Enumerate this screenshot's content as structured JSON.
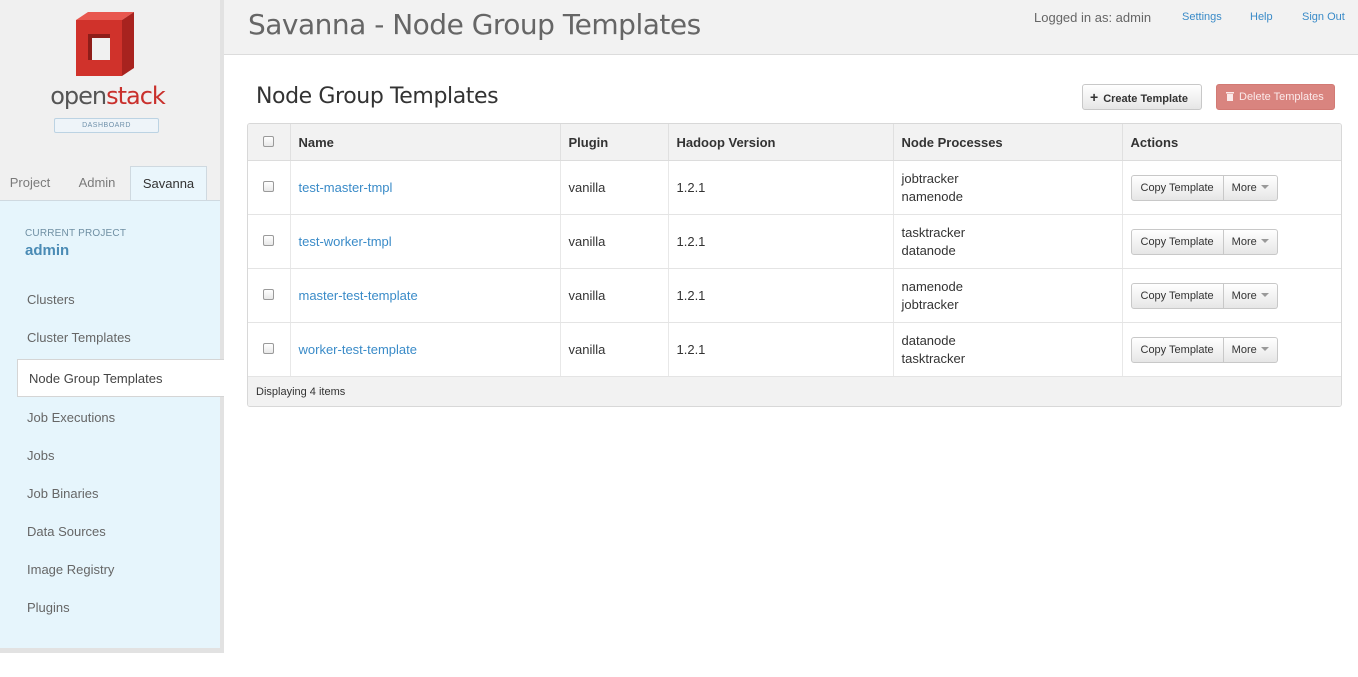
{
  "app": {
    "logo_word_open": "open",
    "logo_word_stack": "stack",
    "logo_badge": "DASHBOARD",
    "title": "Savanna - Node Group Templates"
  },
  "header": {
    "logged_in": "Logged in as: admin",
    "links": [
      "Settings",
      "Help",
      "Sign Out"
    ]
  },
  "sidebar": {
    "tabs": [
      "Project",
      "Admin",
      "Savanna"
    ],
    "active_tab": "Savanna",
    "current_project_label": "CURRENT PROJECT",
    "current_project": "admin",
    "items": [
      {
        "label": "Clusters"
      },
      {
        "label": "Cluster Templates"
      },
      {
        "label": "Node Group Templates",
        "active": true
      },
      {
        "label": "Job Executions"
      },
      {
        "label": "Jobs"
      },
      {
        "label": "Job Binaries"
      },
      {
        "label": "Data Sources"
      },
      {
        "label": "Image Registry"
      },
      {
        "label": "Plugins"
      }
    ]
  },
  "main": {
    "section_title": "Node Group Templates",
    "create_label": "Create Template",
    "delete_label": "Delete Templates",
    "columns": [
      "Name",
      "Plugin",
      "Hadoop Version",
      "Node Processes",
      "Actions"
    ],
    "rows": [
      {
        "name": "test-master-tmpl",
        "plugin": "vanilla",
        "version": "1.2.1",
        "processes": [
          "jobtracker",
          "namenode"
        ]
      },
      {
        "name": "test-worker-tmpl",
        "plugin": "vanilla",
        "version": "1.2.1",
        "processes": [
          "tasktracker",
          "datanode"
        ]
      },
      {
        "name": "master-test-template",
        "plugin": "vanilla",
        "version": "1.2.1",
        "processes": [
          "namenode",
          "jobtracker"
        ]
      },
      {
        "name": "worker-test-template",
        "plugin": "vanilla",
        "version": "1.2.1",
        "processes": [
          "datanode",
          "tasktracker"
        ]
      }
    ],
    "row_action_label": "Copy Template",
    "row_more_label": "More",
    "footer": "Displaying 4 items"
  },
  "colors": {
    "link": "#3a8bc8",
    "danger": "#d9847f",
    "brand_red": "#c9302c"
  }
}
